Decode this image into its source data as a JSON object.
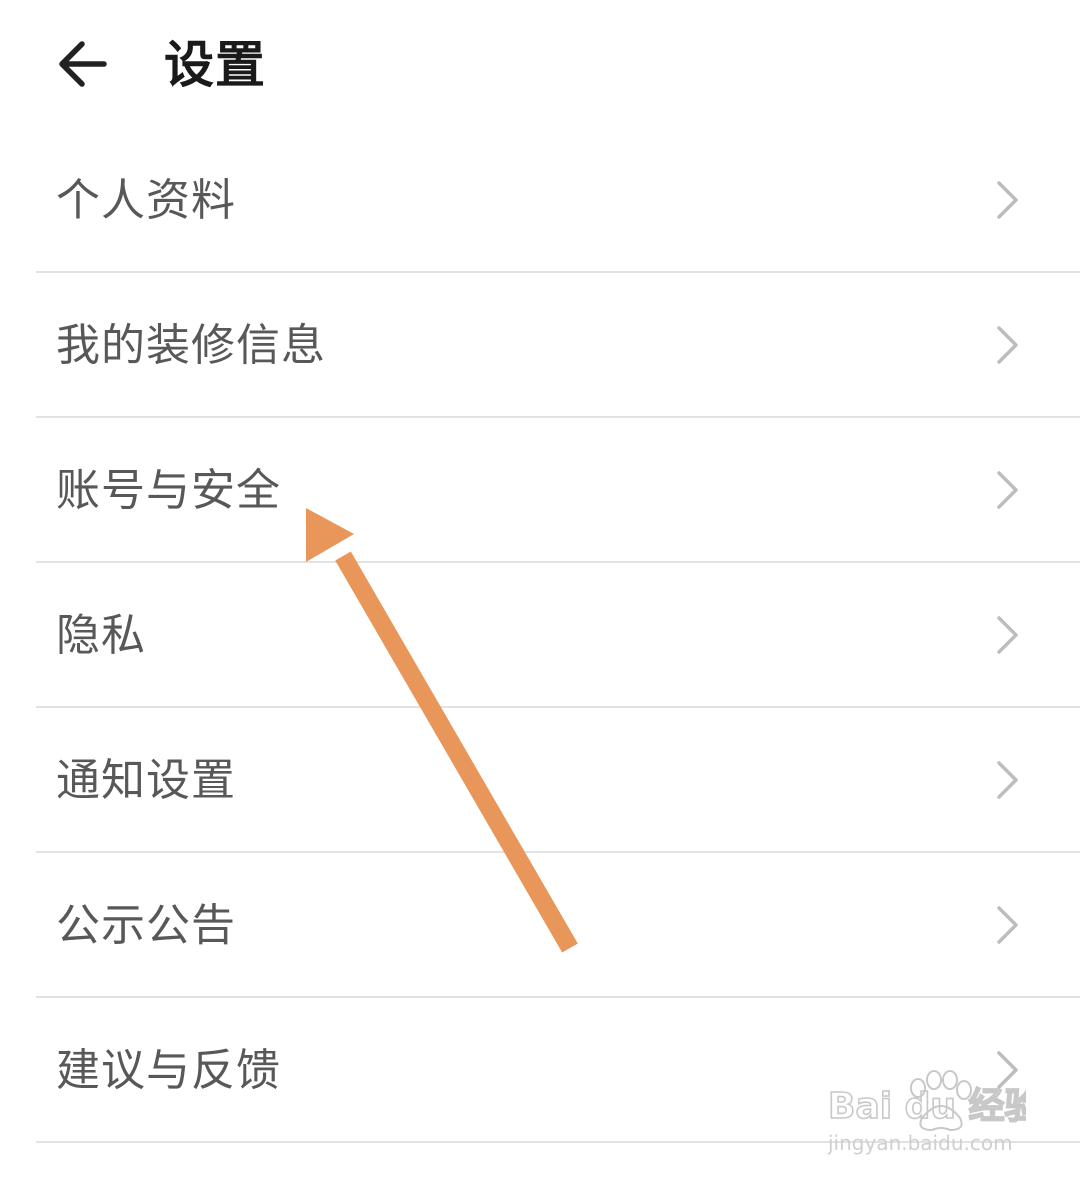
{
  "header": {
    "title": "设置",
    "back_icon": "arrow-left-icon"
  },
  "menu": {
    "items": [
      {
        "label": "个人资料"
      },
      {
        "label": "我的装修信息"
      },
      {
        "label": "账号与安全"
      },
      {
        "label": "隐私"
      },
      {
        "label": "通知设置"
      },
      {
        "label": "公示公告"
      },
      {
        "label": "建议与反馈"
      }
    ],
    "chevron_icon": "chevron-right-icon"
  },
  "annotation": {
    "arrow_color": "#E8965A",
    "target": "账号与安全"
  },
  "watermark": {
    "brand": "Bai du 经验",
    "url": "jingyan.baidu.com"
  },
  "colors": {
    "title": "#1A1A1A",
    "label": "#585858",
    "chevron": "#BDBDBD",
    "divider": "#E2E2E2",
    "background": "#FFFFFF"
  }
}
